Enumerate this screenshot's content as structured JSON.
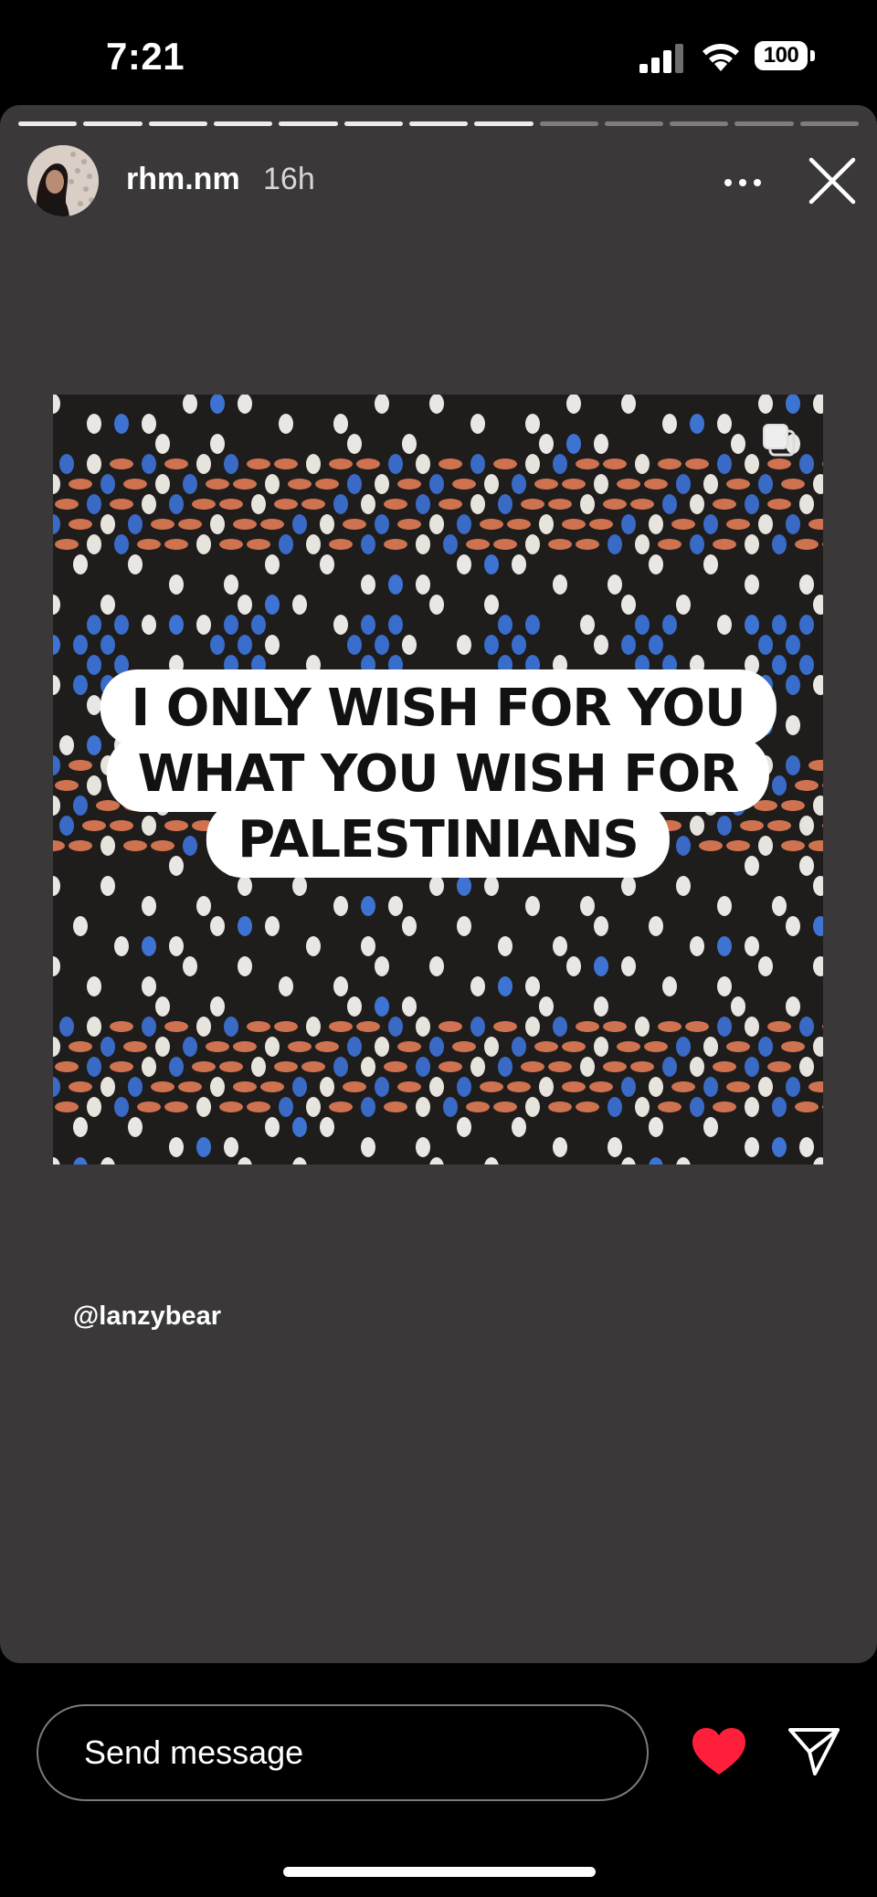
{
  "status_bar": {
    "time": "7:21",
    "battery": "100",
    "icons": [
      "signal-icon",
      "wifi-icon",
      "battery-icon"
    ]
  },
  "story": {
    "username": "rhm.nm",
    "age": "16h",
    "progress_segments_total": 13,
    "progress_segments_viewed": 8,
    "caption_lines": [
      "I ONLY WISH FOR YOU",
      "WHAT YOU WISH FOR",
      "PALESTINIANS"
    ],
    "mention": "@lanzybear",
    "colors": {
      "card_bg": "#3a3839",
      "heart": "#ff1f3b"
    }
  },
  "footer": {
    "message_placeholder": "Send message",
    "icons": [
      "heart-icon",
      "send-icon"
    ]
  }
}
